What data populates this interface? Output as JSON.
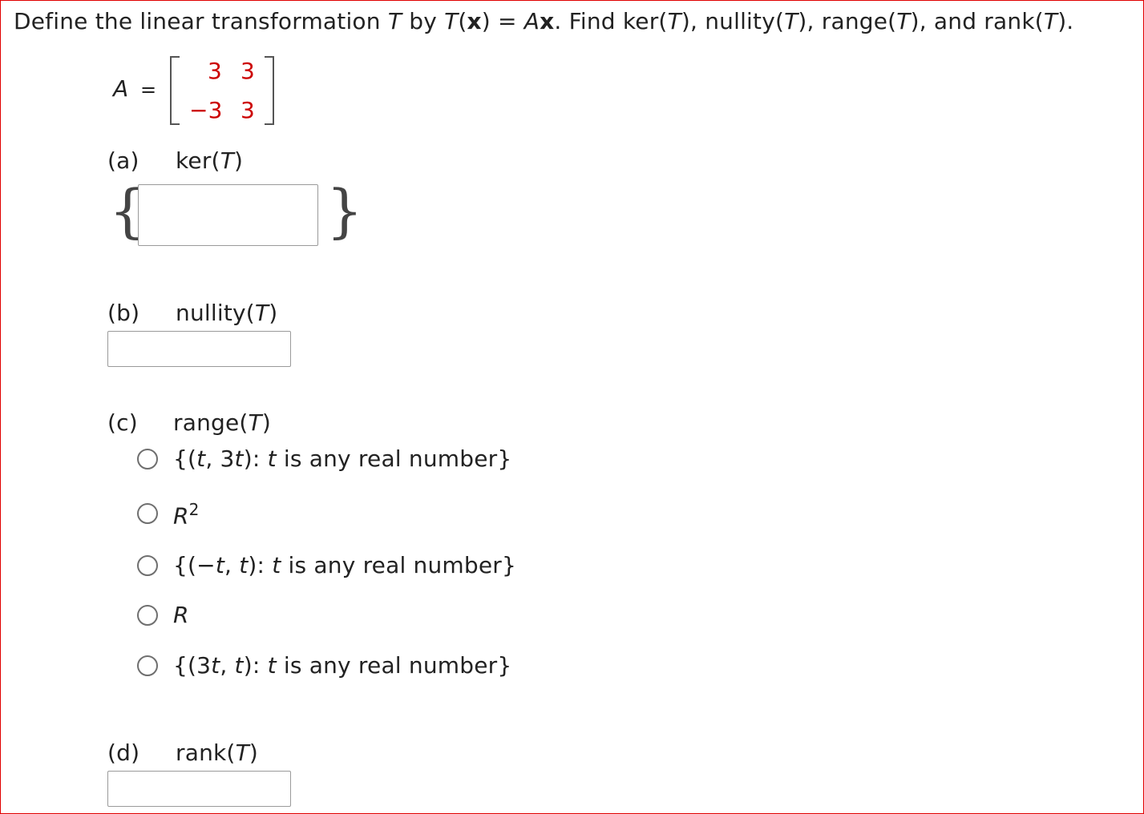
{
  "question": {
    "t1": "Define the linear transformation ",
    "T": "T",
    "t2": " by ",
    "t3": "(",
    "x": "x",
    "t4": ") = ",
    "A": "A",
    "t5": ". Find ker(",
    "t6": "), nullity(",
    "t7": "), range(",
    "t8": "), and rank(",
    "t9": ")."
  },
  "matrix": {
    "label": "A",
    "equals": "=",
    "rows": [
      [
        "3",
        "3"
      ],
      [
        "−3",
        "3"
      ]
    ],
    "entry_color": "#cc0000"
  },
  "parts": {
    "a": {
      "letter": "(a)",
      "label_pre": "ker(",
      "label_var": "T",
      "label_post": ")",
      "open_brace": "{",
      "close_brace": "}",
      "value": ""
    },
    "b": {
      "letter": "(b)",
      "label_pre": "nullity(",
      "label_var": "T",
      "label_post": ")",
      "value": ""
    },
    "c": {
      "letter": "(c)",
      "label_pre": "range(",
      "label_var": "T",
      "label_post": ")",
      "options": [
        {
          "p1": "{(",
          "v1": "t",
          "p2": ", 3",
          "v2": "t",
          "p3": "): ",
          "v3": "t",
          "p4": " is any real number}"
        },
        {
          "base": "R",
          "sup": "2"
        },
        {
          "p1": "{(−",
          "v1": "t",
          "p2": ", ",
          "v2": "t",
          "p3": "): ",
          "v3": "t",
          "p4": " is any real number}"
        },
        {
          "base": "R"
        },
        {
          "p1": "{(3",
          "v1": "t",
          "p2": ", ",
          "v2": "t",
          "p3": "): ",
          "v3": "t",
          "p4": " is any real number}"
        }
      ]
    },
    "d": {
      "letter": "(d)",
      "label_pre": "rank(",
      "label_var": "T",
      "label_post": ")",
      "value": ""
    }
  },
  "colors": {
    "border": "#e00000",
    "text": "#222222",
    "input_border": "#9a9a9a"
  }
}
